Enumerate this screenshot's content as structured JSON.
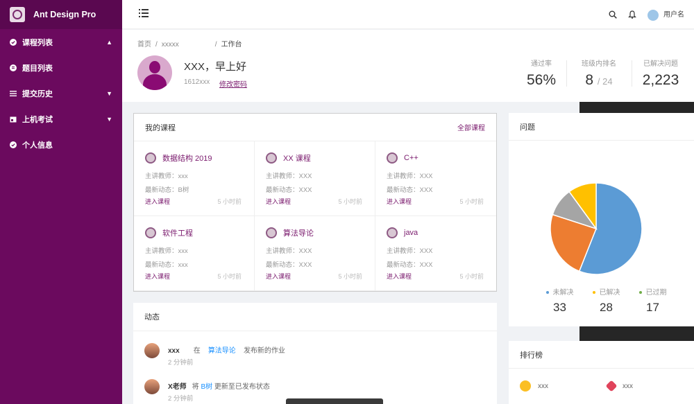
{
  "app": {
    "title": "Ant Design Pro"
  },
  "sidebar": {
    "items": [
      {
        "label": "课程列表",
        "icon": "check-circle-icon",
        "arrow": "▲"
      },
      {
        "label": "题目列表",
        "icon": "list-circle-icon",
        "arrow": ""
      },
      {
        "label": "提交历史",
        "icon": "bars-icon",
        "arrow": "▼"
      },
      {
        "label": "上机考试",
        "icon": "calendar-icon",
        "arrow": "▼"
      },
      {
        "label": "个人信息",
        "icon": "check-circle-icon",
        "arrow": ""
      }
    ]
  },
  "header": {
    "user_name": "用户名"
  },
  "breadcrumb": {
    "home": "首页",
    "middle": "xxxxx",
    "current": "工作台"
  },
  "profile": {
    "greeting": "XXX，早上好",
    "id": "1612xxx",
    "change_password": "修改密码"
  },
  "stats": {
    "pass_rate": {
      "label": "通过率",
      "value": "56%"
    },
    "rank": {
      "label": "班级内排名",
      "value": "8",
      "total": "/ 24"
    },
    "solved": {
      "label": "已解决问题",
      "value": "2,223"
    }
  },
  "courses": {
    "title": "我的课程",
    "all_link": "全部课程",
    "items": [
      {
        "name": "数据结构 2019",
        "teacher": "主讲教师：xxx",
        "news": "最新动态：B树",
        "enter": "进入课程",
        "time": "5 小时前"
      },
      {
        "name": "XX 课程",
        "teacher": "主讲教师：XXX",
        "news": "最新动态：XXX",
        "enter": "进入课程",
        "time": "5 小时前"
      },
      {
        "name": "C++",
        "teacher": "主讲教师：XXX",
        "news": "最新动态：XXX",
        "enter": "进入课程",
        "time": "5 小时前"
      },
      {
        "name": "软件工程",
        "teacher": "主讲教师：xxx",
        "news": "最新动态：xxx",
        "enter": "进入课程",
        "time": "5 小时前"
      },
      {
        "name": "算法导论",
        "teacher": "主讲教师：XXX",
        "news": "最新动态：XXX",
        "enter": "进入课程",
        "time": "5 小时前"
      },
      {
        "name": "java",
        "teacher": "主讲教师：XXX",
        "news": "最新动态：XXX",
        "enter": "进入课程",
        "time": "5 小时前"
      }
    ]
  },
  "activity": {
    "title": "动态",
    "items": [
      {
        "user": "xxx",
        "pre": "在",
        "link": "算法导论",
        "post": "发布新的作业",
        "time": "2 分钟前"
      },
      {
        "user": "X老师",
        "pre": "将",
        "link": "B树",
        "post": "更新至已发布状态",
        "time": "2 分钟前"
      }
    ]
  },
  "problems": {
    "title": "问题",
    "legend": [
      {
        "label": "未解决",
        "value": "33",
        "color": "#5b9bd5"
      },
      {
        "label": "已解决",
        "value": "28",
        "color": "#ffc000"
      },
      {
        "label": "已过期",
        "value": "17",
        "color": "#70ad47"
      }
    ]
  },
  "chart_data": {
    "type": "pie",
    "values": [
      56,
      24,
      10,
      10
    ],
    "colors": [
      "#5b9bd5",
      "#ed7d31",
      "#a5a5a5",
      "#ffc000"
    ]
  },
  "ranking": {
    "title": "排行榜",
    "items": [
      {
        "name": "xxx",
        "color": "#fbbf24"
      },
      {
        "name": "xxx",
        "color": "#e0435b"
      }
    ]
  }
}
